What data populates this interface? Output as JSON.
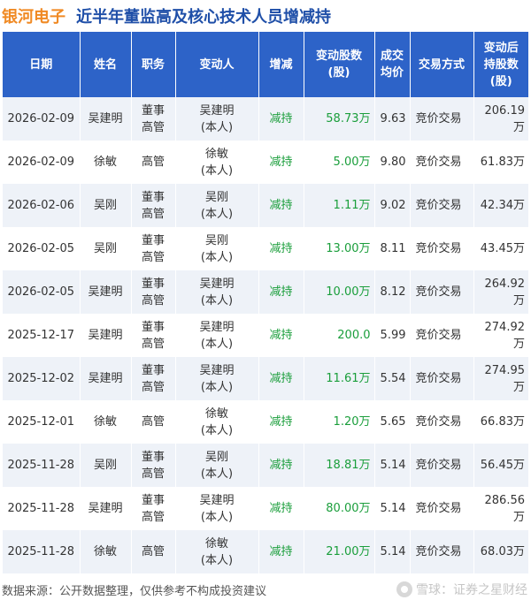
{
  "header": {
    "company": "银河电子",
    "title": "近半年董监高及核心技术人员增减持"
  },
  "table": {
    "columns": [
      [
        "日期"
      ],
      [
        "姓名"
      ],
      [
        "职务"
      ],
      [
        "变动人"
      ],
      [
        "增减"
      ],
      [
        "变动股数",
        "(股)"
      ],
      [
        "成交",
        "均价"
      ],
      [
        "交易方式"
      ],
      [
        "变动后",
        "持股数",
        "(股)"
      ]
    ],
    "rows": [
      {
        "date": "2026-02-09",
        "name": "吴建明",
        "role": [
          "董事",
          "高管"
        ],
        "changer": [
          "吴建明",
          "(本人)"
        ],
        "direction": "减持",
        "shares": "58.73万",
        "price": "9.63",
        "method": "竞价交易",
        "after": "206.19万"
      },
      {
        "date": "2026-02-09",
        "name": "徐敏",
        "role": [
          "高管"
        ],
        "changer": [
          "徐敏",
          "(本人)"
        ],
        "direction": "减持",
        "shares": "5.00万",
        "price": "9.80",
        "method": "竞价交易",
        "after": "61.83万"
      },
      {
        "date": "2026-02-06",
        "name": "吴刚",
        "role": [
          "董事",
          "高管"
        ],
        "changer": [
          "吴刚",
          "(本人)"
        ],
        "direction": "减持",
        "shares": "1.11万",
        "price": "9.02",
        "method": "竞价交易",
        "after": "42.34万"
      },
      {
        "date": "2026-02-05",
        "name": "吴刚",
        "role": [
          "董事",
          "高管"
        ],
        "changer": [
          "吴刚",
          "(本人)"
        ],
        "direction": "减持",
        "shares": "13.00万",
        "price": "8.11",
        "method": "竞价交易",
        "after": "43.45万"
      },
      {
        "date": "2026-02-05",
        "name": "吴建明",
        "role": [
          "董事",
          "高管"
        ],
        "changer": [
          "吴建明",
          "(本人)"
        ],
        "direction": "减持",
        "shares": "10.00万",
        "price": "8.12",
        "method": "竞价交易",
        "after": "264.92万"
      },
      {
        "date": "2025-12-17",
        "name": "吴建明",
        "role": [
          "董事",
          "高管"
        ],
        "changer": [
          "吴建明",
          "(本人)"
        ],
        "direction": "减持",
        "shares": "200.0",
        "price": "5.99",
        "method": "竞价交易",
        "after": "274.92万"
      },
      {
        "date": "2025-12-02",
        "name": "吴建明",
        "role": [
          "董事",
          "高管"
        ],
        "changer": [
          "吴建明",
          "(本人)"
        ],
        "direction": "减持",
        "shares": "11.61万",
        "price": "5.54",
        "method": "竞价交易",
        "after": "274.95万"
      },
      {
        "date": "2025-12-01",
        "name": "徐敏",
        "role": [
          "高管"
        ],
        "changer": [
          "徐敏",
          "(本人)"
        ],
        "direction": "减持",
        "shares": "1.20万",
        "price": "5.65",
        "method": "竞价交易",
        "after": "66.83万"
      },
      {
        "date": "2025-11-28",
        "name": "吴刚",
        "role": [
          "董事",
          "高管"
        ],
        "changer": [
          "吴刚",
          "(本人)"
        ],
        "direction": "减持",
        "shares": "18.81万",
        "price": "5.14",
        "method": "竞价交易",
        "after": "56.45万"
      },
      {
        "date": "2025-11-28",
        "name": "吴建明",
        "role": [
          "董事",
          "高管"
        ],
        "changer": [
          "吴建明",
          "(本人)"
        ],
        "direction": "减持",
        "shares": "80.00万",
        "price": "5.14",
        "method": "竞价交易",
        "after": "286.56万"
      },
      {
        "date": "2025-11-28",
        "name": "徐敏",
        "role": [
          "高管"
        ],
        "changer": [
          "徐敏",
          "(本人)"
        ],
        "direction": "减持",
        "shares": "21.00万",
        "price": "5.14",
        "method": "竞价交易",
        "after": "68.03万"
      }
    ]
  },
  "footer": {
    "source": "数据来源：公开数据整理，仅供参考不构成投资建议",
    "brand": "雪球：证券之星财经",
    "brand_icon": "snowball-logo-icon"
  },
  "colors": {
    "company": "#f08a24",
    "title": "#1f4fa8",
    "header_bg": "#2d63c8",
    "row_alt_bg": "#eef2f8",
    "green": "#1a9e3b"
  }
}
